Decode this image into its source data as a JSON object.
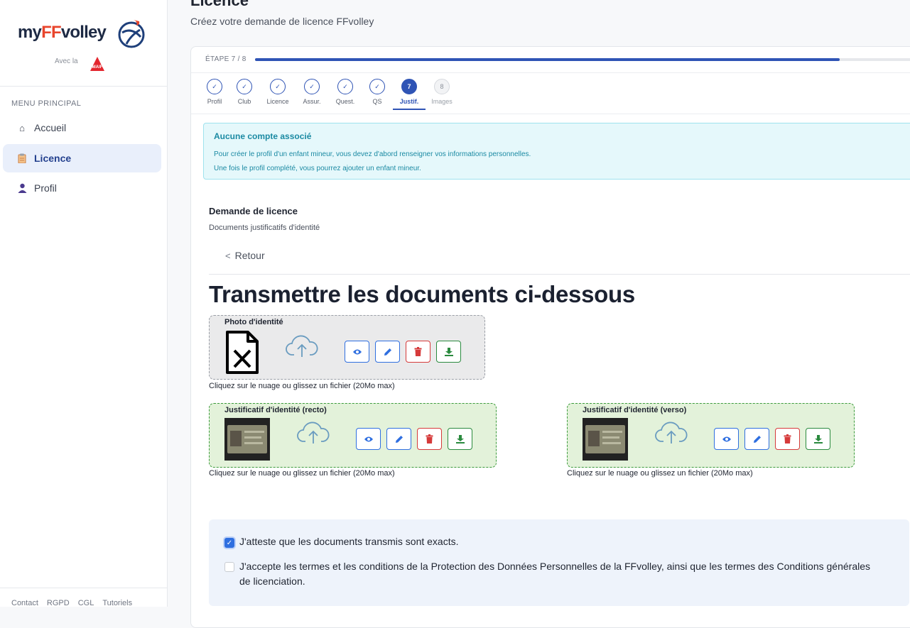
{
  "sidebar": {
    "logo_my": "my",
    "logo_ff": "FF",
    "logo_volley": "volley",
    "avec": "Avec la",
    "maif": "MAIF",
    "menu_label": "MENU PRINCIPAL",
    "items": [
      {
        "label": "Accueil",
        "icon": "home-icon"
      },
      {
        "label": "Licence",
        "icon": "clipboard-icon",
        "active": true
      },
      {
        "label": "Profil",
        "icon": "user-icon"
      }
    ],
    "footer": [
      "Contact",
      "RGPD",
      "CGL",
      "Tutoriels"
    ]
  },
  "header": {
    "title": "Licence",
    "subtitle": "Créez votre demande de licence FFvolley"
  },
  "stepper": {
    "label": "ÉTAPE 7 / 8",
    "progress": 0.875,
    "steps": [
      {
        "num": "✓",
        "name": "Profil",
        "state": "done"
      },
      {
        "num": "✓",
        "name": "Club",
        "state": "done"
      },
      {
        "num": "✓",
        "name": "Licence",
        "state": "done"
      },
      {
        "num": "✓",
        "name": "Assur.",
        "state": "done"
      },
      {
        "num": "✓",
        "name": "Quest.",
        "state": "done"
      },
      {
        "num": "✓",
        "name": "QS",
        "state": "done"
      },
      {
        "num": "7",
        "name": "Justif.",
        "state": "current"
      },
      {
        "num": "8",
        "name": "Images",
        "state": "todo"
      }
    ]
  },
  "alert": {
    "title": "Aucune compte associé",
    "line1": "Pour créer le profil d'un enfant mineur, vous devez d'abord renseigner vos informations personnelles.",
    "line2": "Une fois le profil complété, vous pourrez ajouter un enfant mineur."
  },
  "section": {
    "title": "Demande de licence",
    "subtitle": "Documents justificatifs d'identité",
    "back": "Retour",
    "heading": "Transmettre les documents ci-dessous"
  },
  "documents": {
    "photo": {
      "title": "Photo d'identité",
      "hint": "Cliquez sur le nuage ou glissez un fichier (20Mo max)"
    },
    "recto": {
      "title": "Justificatif d'identité (recto)",
      "hint": "Cliquez sur le nuage ou glissez un fichier (20Mo max)"
    },
    "verso": {
      "title": "Justificatif d'identité (verso)",
      "hint": "Cliquez sur le nuage ou glissez un fichier (20Mo max)"
    }
  },
  "consent": {
    "accuracy": "J'atteste que les documents transmis sont exacts.",
    "accuracy_checked": true,
    "terms_line1": "J'accepte les termes et les conditions de la Protection des Données Personnelles de la FFvolley, ainsi que les termes des Conditions générales",
    "terms_line2": "de licenciation.",
    "terms_checked": false
  },
  "colors": {
    "primary": "#2f54b5",
    "accent": "#e8452c",
    "info": "#1b8aa3",
    "success": "#2a8a3e",
    "danger": "#d63a3a"
  }
}
